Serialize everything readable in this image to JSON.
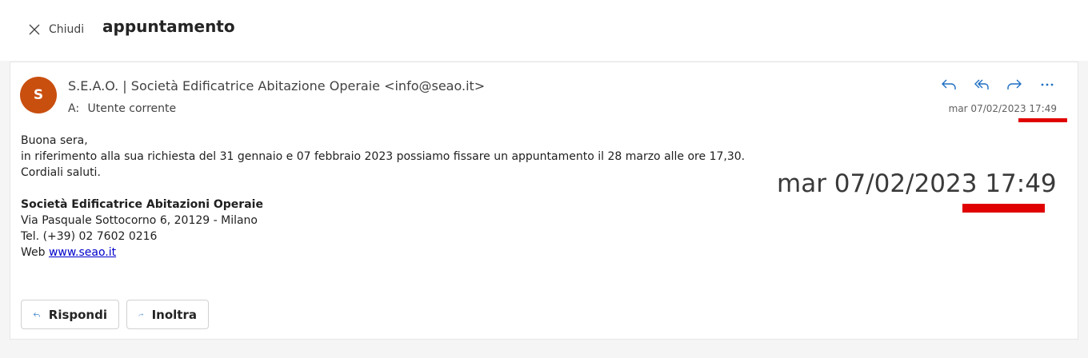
{
  "header": {
    "close_label": "Chiudi",
    "subject": "appuntamento"
  },
  "message": {
    "avatar_initial": "S",
    "avatar_color": "#c94f0f",
    "sender": "S.E.A.O. | Società Edificatrice Abitazione Operaie <info@seao.it>",
    "recipient_label": "A:",
    "recipient": "Utente corrente",
    "datetime": "mar 07/02/2023 17:49",
    "actions": [
      "reply-icon",
      "reply-all-icon",
      "forward-icon",
      "more-icon"
    ],
    "body": {
      "greeting": "Buona sera,",
      "line1": "in riferimento alla sua richiesta del 31 gennaio e 07 febbraio 2023 possiamo fissare un appuntamento il 28 marzo alle ore 17,30.",
      "closing": "Cordiali saluti.",
      "sig_name": "Società Edificatrice Abitazioni Operaie",
      "sig_address": "Via Pasquale Sottocorno 6, 20129 - Milano",
      "sig_phone": "Tel. (+39) 02 7602 0216",
      "sig_web_label": "Web",
      "sig_web_link": "www.seao.it"
    }
  },
  "annotation": {
    "zoomed_datetime": "mar 07/02/2023 17:49",
    "highlight_color": "#e00000"
  },
  "footer": {
    "reply_label": "Rispondi",
    "forward_label": "Inoltra"
  }
}
